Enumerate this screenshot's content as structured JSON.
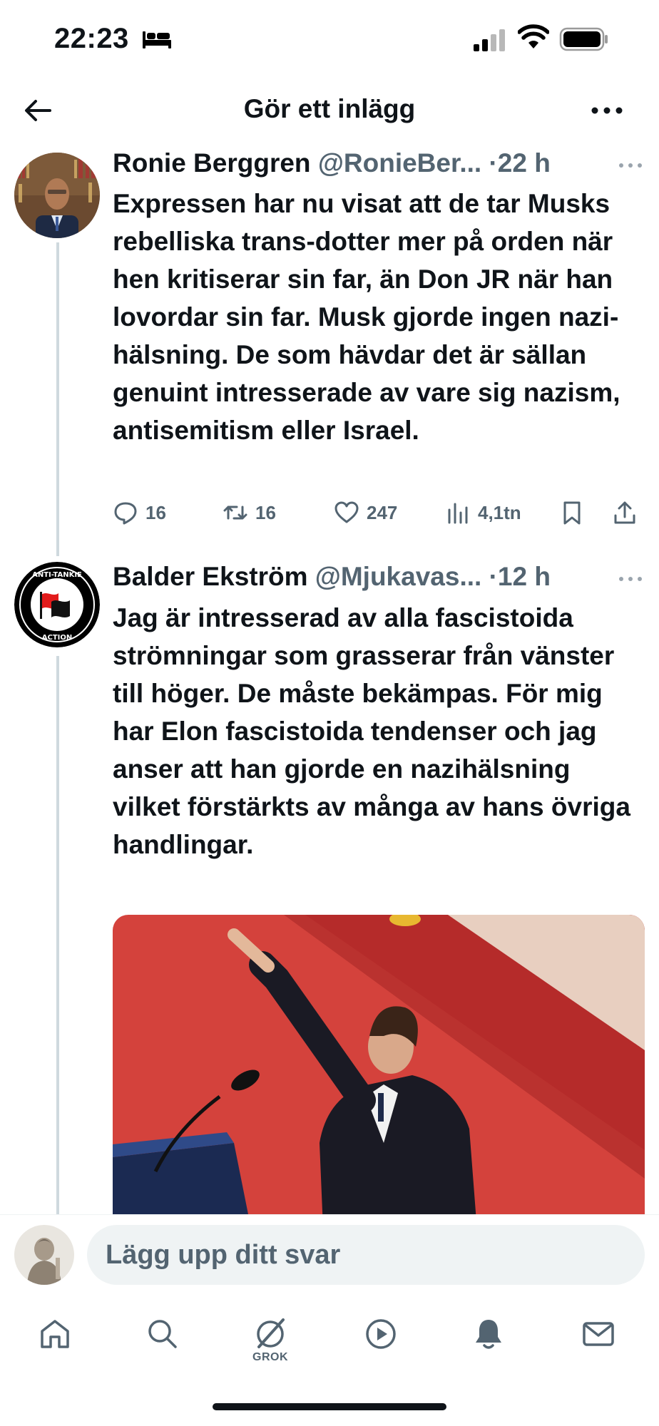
{
  "status_bar": {
    "time": "22:23",
    "icons": [
      "bed-icon",
      "cellular-signal-icon",
      "wifi-icon",
      "battery-icon"
    ]
  },
  "header": {
    "title": "Gör ett inlägg",
    "back_icon": "arrow-left-icon",
    "more_icon": "more-horizontal-icon"
  },
  "tweets": [
    {
      "name": "Ronie Berggren",
      "handle": "@RonieBer...",
      "time": "·22 h",
      "text": "Expressen har nu visat att de tar Musks rebelliska trans-dotter mer på orden när hen kritiserar sin far, än Don JR när han lovordar sin far. Musk gjorde ingen nazi-hälsning. De som hävdar det är sällan genuint intresserade av vare sig nazism, antisemitism eller Israel.",
      "replies": "16",
      "reposts": "16",
      "likes": "247",
      "views": "4,1tn"
    },
    {
      "name": "Balder Ekström",
      "handle": "@Mjukavas...",
      "time": "·12 h",
      "text": "Jag är intresserad av alla fascistoida strömningar som grasserar från vänster till höger. De måste bekämpas. För mig har Elon fascistoida tendenser och jag anser att han gjorde en nazihälsning vilket förstärkts av många av hans övriga handlingar.",
      "avatar_text_top": "ANTI-TANKIE",
      "avatar_text_bottom": "ACTION"
    }
  ],
  "reply": {
    "placeholder": "Lägg upp ditt svar"
  },
  "nav": {
    "items": [
      "home-icon",
      "search-icon",
      "grok-icon",
      "video-icon",
      "notifications-icon",
      "messages-icon"
    ],
    "grok_label": "GROK"
  },
  "colors": {
    "text": "#0f1419",
    "secondary": "#536471",
    "thread_line": "#cfd9de",
    "input_bg": "#eff3f4",
    "media_red": "#cf3a35"
  }
}
